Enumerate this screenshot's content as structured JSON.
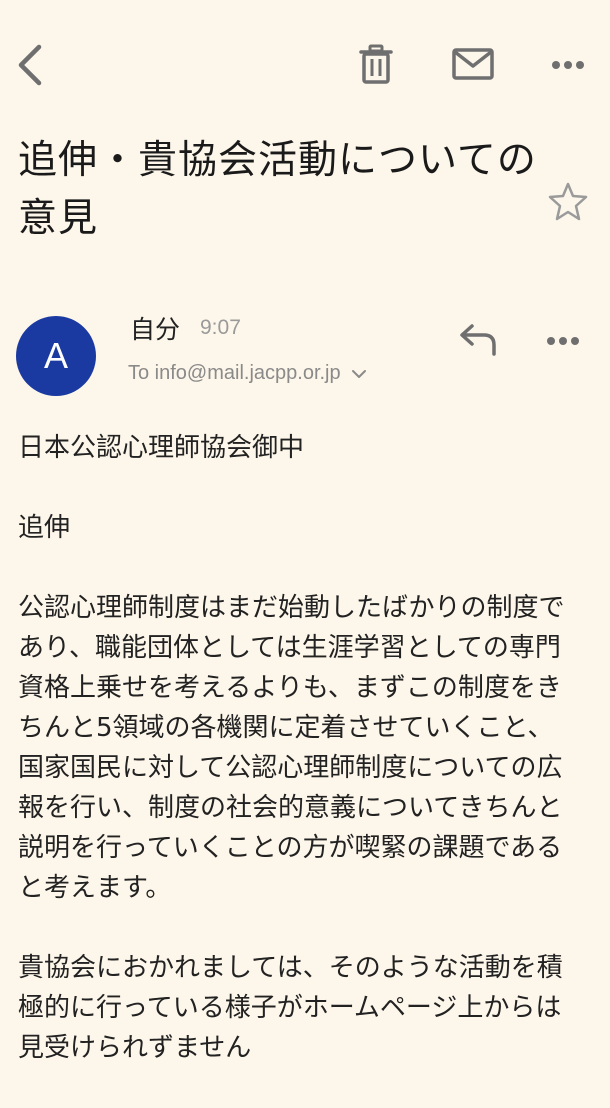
{
  "toolbar": {
    "back_icon": "chevron-left-icon",
    "delete_icon": "trash-icon",
    "mark_icon": "envelope-icon",
    "more_icon": "more-horizontal-icon"
  },
  "email": {
    "subject": "追伸・貴協会活動についての意見",
    "sender": "自分",
    "avatar_letter": "A",
    "time": "9:07",
    "recipient": "To info@mail.jacpp.or.jp",
    "body": {
      "salutation": "日本公認心理師協会御中",
      "p1": "追伸",
      "p2": "公認心理師制度はまだ始動したばかりの制度であり、職能団体としては生涯学習としての専門資格上乗せを考えるよりも、まずこの制度をきちんと5領域の各機関に定着させていくこと、国家国民に対して公認心理師制度についての広報を行い、制度の社会的意義についてきちんと説明を行っていくことの方が喫緊の課題であると考えます。",
      "p3": "貴協会におかれましては、そのような活動を積極的に行っている様子がホームページ上からは見受けられずません"
    }
  },
  "colors": {
    "background": "#fdf6ea",
    "avatar": "#1a3aa1",
    "icon": "#6f6f6f"
  }
}
